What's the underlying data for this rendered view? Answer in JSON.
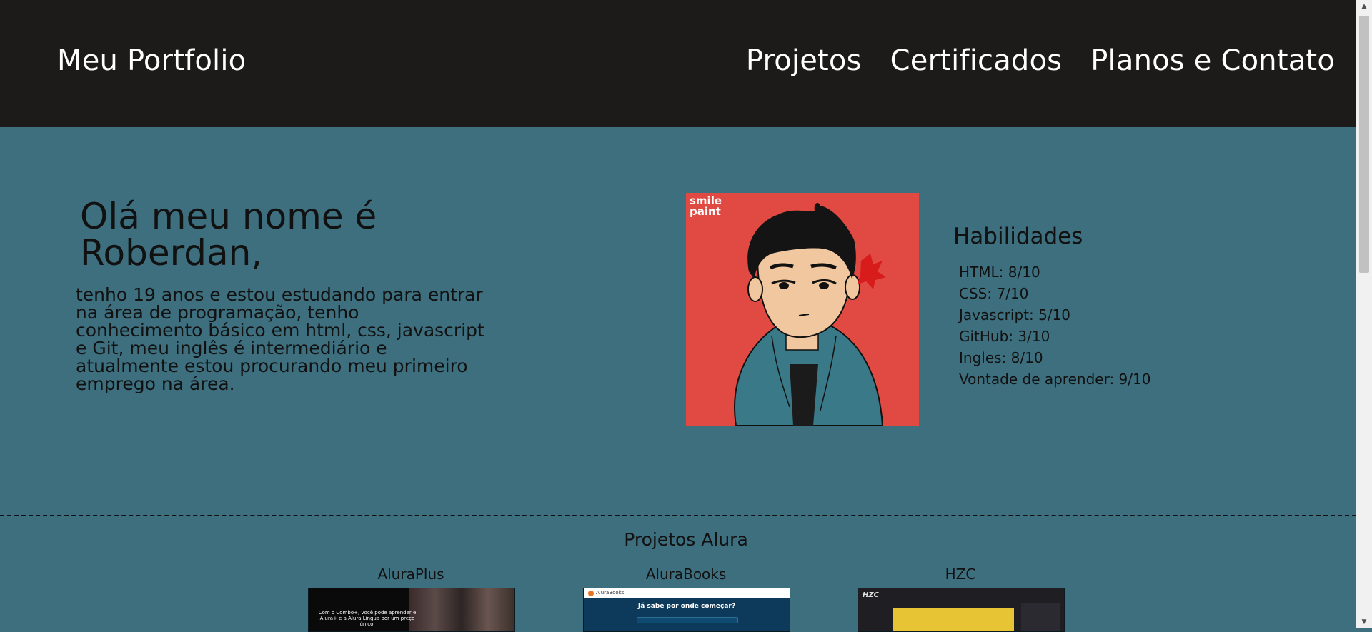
{
  "header": {
    "brand": "Meu Portfolio",
    "nav": [
      "Projetos",
      "Certificados",
      "Planos e Contato"
    ]
  },
  "hero": {
    "title": "Olá meu nome é Roberdan,",
    "text": "tenho 19 anos e estou estudando para entrar na área de programação, tenho conhecimento básico em html, css, javascript e Git, meu inglês é intermediário e atualmente estou procurando meu primeiro emprego na área.",
    "avatar_badge_line1": "smile",
    "avatar_badge_line2": "paint"
  },
  "skills": {
    "title": "Habilidades",
    "items": [
      "HTML: 8/10",
      "CSS: 7/10",
      "Javascript: 5/10",
      "GitHub: 3/10",
      "Ingles: 8/10",
      "Vontade de aprender: 9/10"
    ]
  },
  "projects": {
    "title": "Projetos Alura",
    "items": [
      {
        "name": "AluraPlus",
        "thumb_text": "Com o Combo+, você pode aprender e Alura+ e a Alura Língua por um preço único."
      },
      {
        "name": "AluraBooks",
        "thumb_brand": "AluraBooks",
        "thumb_text": "Já sabe por onde começar?"
      },
      {
        "name": "HZC",
        "thumb_text": "HZC"
      }
    ]
  },
  "colors": {
    "header_bg": "#1d1b1a",
    "page_bg": "#3d6f7f",
    "avatar_bg": "#e04a42"
  }
}
